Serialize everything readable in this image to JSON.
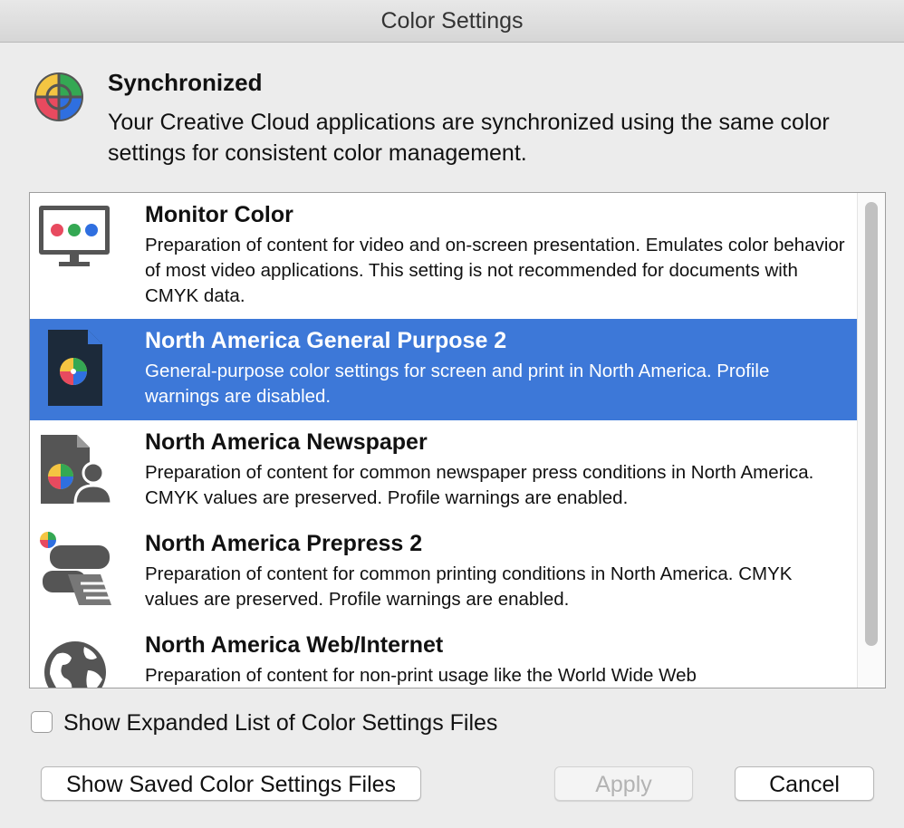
{
  "window": {
    "title": "Color Settings"
  },
  "sync": {
    "icon": "color-wheel-icon",
    "title": "Synchronized",
    "description": "Your Creative Cloud applications are synchronized using the same color settings for consistent color management."
  },
  "settings_list": {
    "selected_index": 1,
    "items": [
      {
        "icon": "monitor-icon",
        "title": "Monitor Color",
        "description": "Preparation of content for video and on-screen presentation. Emulates color behavior of most video applications. This setting is not recommended for documents with CMYK data."
      },
      {
        "icon": "document-color-icon",
        "title": "North America General Purpose 2",
        "description": "General-purpose color settings for screen and print in North America. Profile warnings are disabled."
      },
      {
        "icon": "newspaper-icon",
        "title": "North America Newspaper",
        "description": "Preparation of content for common newspaper press conditions in North America. CMYK values are preserved. Profile warnings are enabled."
      },
      {
        "icon": "printing-press-icon",
        "title": "North America Prepress 2",
        "description": "Preparation of content for common printing conditions in North America. CMYK values are preserved. Profile warnings are enabled."
      },
      {
        "icon": "globe-icon",
        "title": "North America Web/Internet",
        "description": "Preparation of content for non-print usage like the World Wide Web"
      }
    ]
  },
  "expanded_checkbox": {
    "label": "Show Expanded List of Color Settings Files",
    "checked": false
  },
  "buttons": {
    "show_saved": "Show Saved Color Settings Files",
    "apply": "Apply",
    "cancel": "Cancel"
  },
  "colors": {
    "selection": "#3d78d8",
    "window_bg": "#ececec"
  }
}
